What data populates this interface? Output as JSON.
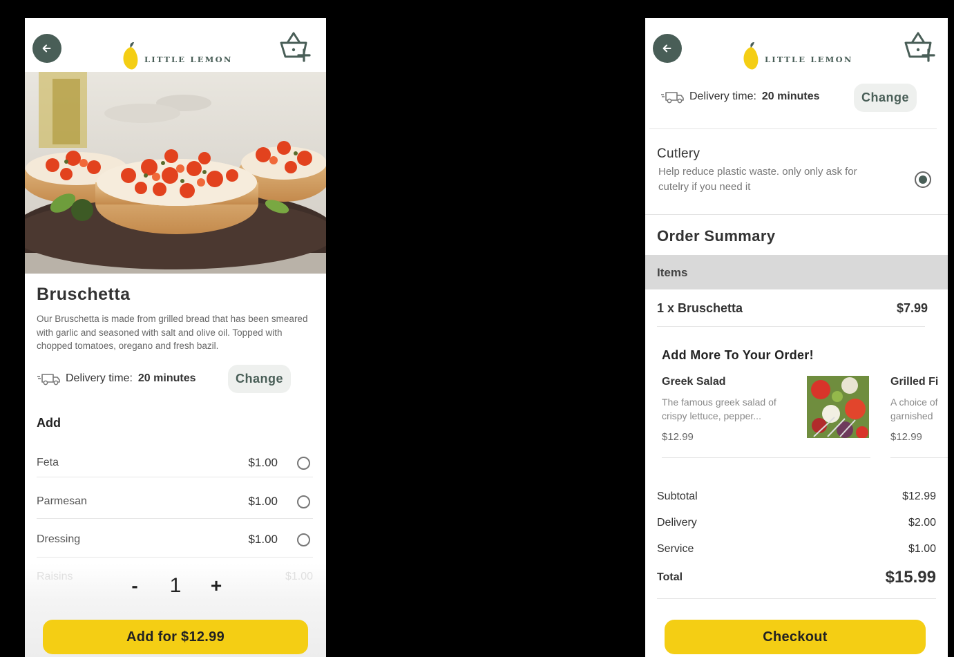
{
  "brand": {
    "name": "LITTLE LEMON",
    "colors": {
      "green": "#495e57",
      "yellow": "#f4ce14",
      "gray_band": "#d9d9d9"
    }
  },
  "icons": {
    "back": "arrow-left-icon",
    "basket": "basket-add-icon",
    "delivery": "delivery-truck-icon",
    "radio_off": "radio-unselected-icon",
    "radio_on": "radio-selected-icon"
  },
  "product_screen": {
    "title": "Bruschetta",
    "description": "Our Bruschetta is made from grilled bread that has been smeared with garlic and seasoned with salt and olive oil. Topped with chopped tomatoes, oregano and fresh bazil.",
    "delivery_label": "Delivery time:",
    "delivery_value": "20 minutes",
    "change_label": "Change",
    "add_heading": "Add",
    "addons": [
      {
        "name": "Feta",
        "price": "$1.00",
        "selected": false
      },
      {
        "name": "Parmesan",
        "price": "$1.00",
        "selected": false
      },
      {
        "name": "Dressing",
        "price": "$1.00",
        "selected": false
      }
    ],
    "hidden_addon": {
      "name": "Raisins",
      "price": "$1.00"
    },
    "quantity": {
      "minus": "-",
      "value": "1",
      "plus": "+"
    },
    "add_button": "Add for $12.99"
  },
  "checkout_screen": {
    "delivery_label": "Delivery time:",
    "delivery_value": "20 minutes",
    "change_label": "Change",
    "cutlery": {
      "title": "Cutlery",
      "description": "Help reduce plastic waste. only only ask for cutelry if you need it",
      "selected": true
    },
    "summary_title": "Order Summary",
    "items_header": "Items",
    "line_items": [
      {
        "label": "1 x Bruschetta",
        "price": "$7.99"
      }
    ],
    "upsell_heading": "Add More To Your Order!",
    "upsell": [
      {
        "name": "Greek Salad",
        "description": "The famous greek salad of crispy lettuce, pepper...",
        "price": "$12.99"
      },
      {
        "name": "Grilled Fi",
        "description": "A choice of garnished",
        "price": "$12.99"
      }
    ],
    "totals": [
      {
        "label": "Subtotal",
        "value": "$12.99"
      },
      {
        "label": "Delivery",
        "value": "$2.00"
      },
      {
        "label": "Service",
        "value": "$1.00"
      }
    ],
    "total": {
      "label": "Total",
      "value": "$15.99"
    },
    "checkout_button": "Checkout"
  }
}
